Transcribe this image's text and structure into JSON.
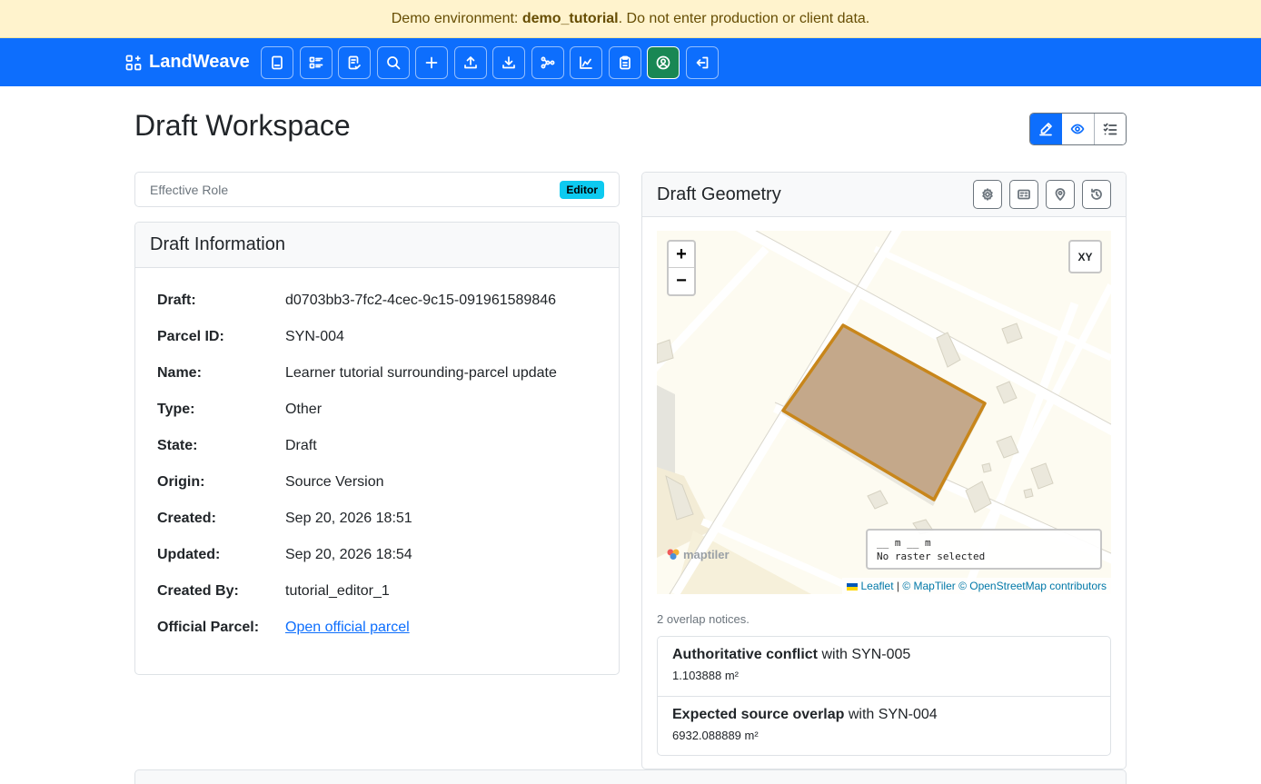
{
  "banner": {
    "prefix": "Demo environment: ",
    "env": "demo_tutorial",
    "suffix": ". Do not enter production or client data."
  },
  "navbar": {
    "brand": "LandWeave",
    "icons": [
      "book-icon",
      "list-details-icon",
      "file-check-icon",
      "search-icon",
      "plus-icon",
      "upload-icon",
      "download-icon",
      "topology-icon",
      "chart-icon",
      "clipboard-icon",
      "user-circle-icon",
      "logout-icon"
    ],
    "active_index": 10
  },
  "page": {
    "title": "Draft Workspace"
  },
  "role": {
    "label": "Effective Role",
    "badge": "Editor"
  },
  "info": {
    "title": "Draft Information",
    "rows": [
      {
        "key": "Draft:",
        "value": "d0703bb3-7fc2-4cec-9c15-091961589846"
      },
      {
        "key": "Parcel ID:",
        "value": "SYN-004"
      },
      {
        "key": "Name:",
        "value": "Learner tutorial surrounding-parcel update"
      },
      {
        "key": "Type:",
        "value": "Other"
      },
      {
        "key": "State:",
        "value": "Draft"
      },
      {
        "key": "Origin:",
        "value": "Source Version"
      },
      {
        "key": "Created:",
        "value": "Sep 20, 2026 18:51"
      },
      {
        "key": "Updated:",
        "value": "Sep 20, 2026 18:54"
      },
      {
        "key": "Created By:",
        "value": "tutorial_editor_1"
      },
      {
        "key": "Official Parcel:",
        "link": "Open official parcel"
      }
    ]
  },
  "geometry": {
    "title": "Draft Geometry",
    "map": {
      "zoom_in": "+",
      "zoom_out": "−",
      "xy_label": "XY",
      "readout_line1": "__ m __ m",
      "readout_line2": "No raster selected",
      "maptiler_label": "maptiler",
      "attribution": {
        "leaflet": "Leaflet",
        "sep": " | ",
        "maptiler": "© MapTiler",
        "osm": "© OpenStreetMap contributors"
      },
      "colors": {
        "background": "#fdfbf1",
        "road": "#ffffff",
        "parcel_fill": "#c4a88a",
        "parcel_stroke": "#c8861b"
      }
    },
    "notices_count": "2 overlap notices.",
    "notices": [
      {
        "title": "Authoritative conflict",
        "with": " with SYN-005",
        "area": "1.103888 m²"
      },
      {
        "title": "Expected source overlap",
        "with": " with SYN-004",
        "area": "6932.088889 m²"
      }
    ]
  },
  "colors": {
    "primary": "#0d6efd",
    "success": "#198754",
    "info_badge": "#0dcaf0",
    "warning_bg": "#fff3cd"
  }
}
